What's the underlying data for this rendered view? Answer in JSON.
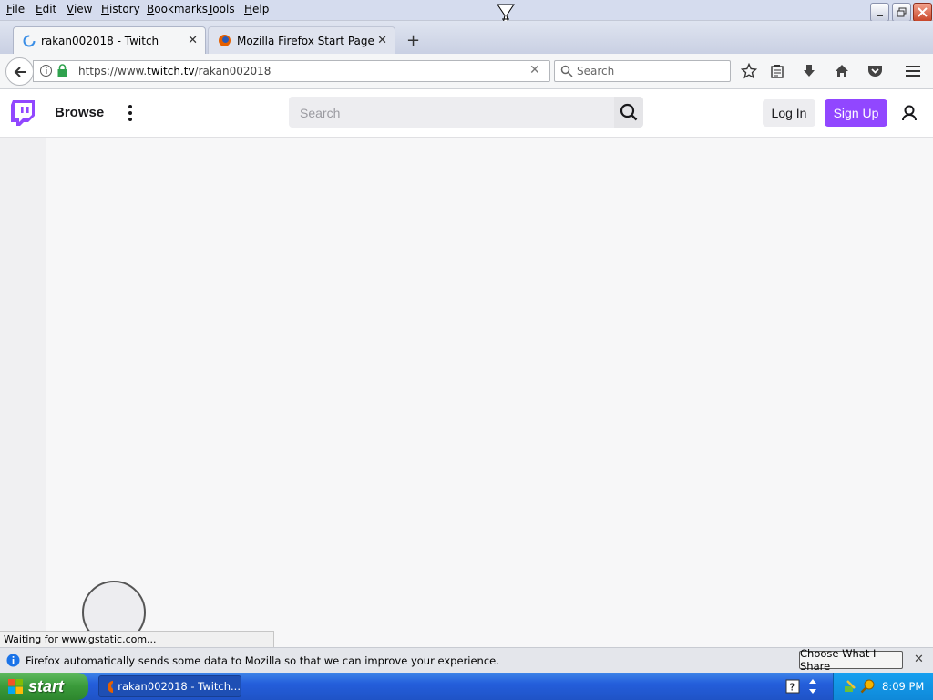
{
  "menubar": {
    "items": [
      "File",
      "Edit",
      "View",
      "History",
      "Bookmarks",
      "Tools",
      "Help"
    ]
  },
  "tabs": [
    {
      "label": "rakan002018 - Twitch",
      "active": true
    },
    {
      "label": "Mozilla Firefox Start Page",
      "active": false
    }
  ],
  "navbar": {
    "url_prefix": "https://www.",
    "url_domain": "twitch.tv",
    "url_path": "/rakan002018",
    "search_placeholder": "Search"
  },
  "twitch": {
    "browse_label": "Browse",
    "search_placeholder": "Search",
    "login_label": "Log In",
    "signup_label": "Sign Up",
    "accent_color": "#9147ff"
  },
  "status": {
    "text": "Waiting for www.gstatic.com..."
  },
  "notification": {
    "text": "Firefox automatically sends some data to Mozilla so that we can improve your experience.",
    "button_label": "Choose What I Share"
  },
  "taskbar": {
    "start_label": "start",
    "task_label": "rakan002018 - Twitch...",
    "clock": "8:09 PM"
  }
}
